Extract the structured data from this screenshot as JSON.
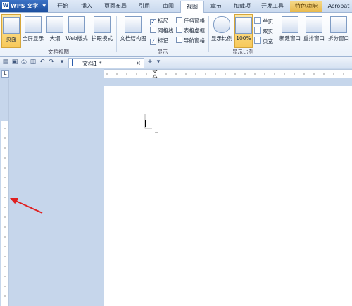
{
  "app": {
    "name": "WPS 文字"
  },
  "tabs": [
    "开始",
    "插入",
    "页面布局",
    "引用",
    "审阅",
    "视图",
    "章节",
    "加载项",
    "开发工具",
    "特色功能",
    "Acrobat"
  ],
  "active_tab": "视图",
  "ribbon": {
    "doc_view": {
      "label": "文档视图",
      "buttons": [
        "页面",
        "全屏显示",
        "大纲",
        "Web版式",
        "护眼模式"
      ]
    },
    "show": {
      "label": "显示",
      "structure_btn": "文档结构图",
      "checks": [
        {
          "label": "标尺",
          "checked": true
        },
        {
          "label": "网格线",
          "checked": false
        },
        {
          "label": "标记",
          "checked": true
        },
        {
          "label": "任务窗格",
          "checked": false
        },
        {
          "label": "表格虚框",
          "checked": false
        },
        {
          "label": "导航窗格",
          "checked": false
        }
      ]
    },
    "zoom": {
      "label": "显示比例",
      "zoom_btn": "显示比例",
      "zoom_value": "100%",
      "single_page": "单页",
      "two_page": "双页",
      "page_width": "页宽"
    },
    "window": {
      "new_window": "新建窗口",
      "arrange": "重排窗口",
      "split": "拆分窗口"
    }
  },
  "doc_tabs": {
    "name": "文档1 *",
    "close": "×",
    "add": "+"
  },
  "quick_icons": [
    "open-icon",
    "save-icon",
    "print-icon",
    "preview-icon",
    "undo-icon",
    "redo-icon"
  ],
  "ruler": {
    "corner": "L"
  },
  "colors": {
    "background": "#c6d6eb",
    "arrow": "#e02020",
    "active_button": "#f7c95a"
  }
}
